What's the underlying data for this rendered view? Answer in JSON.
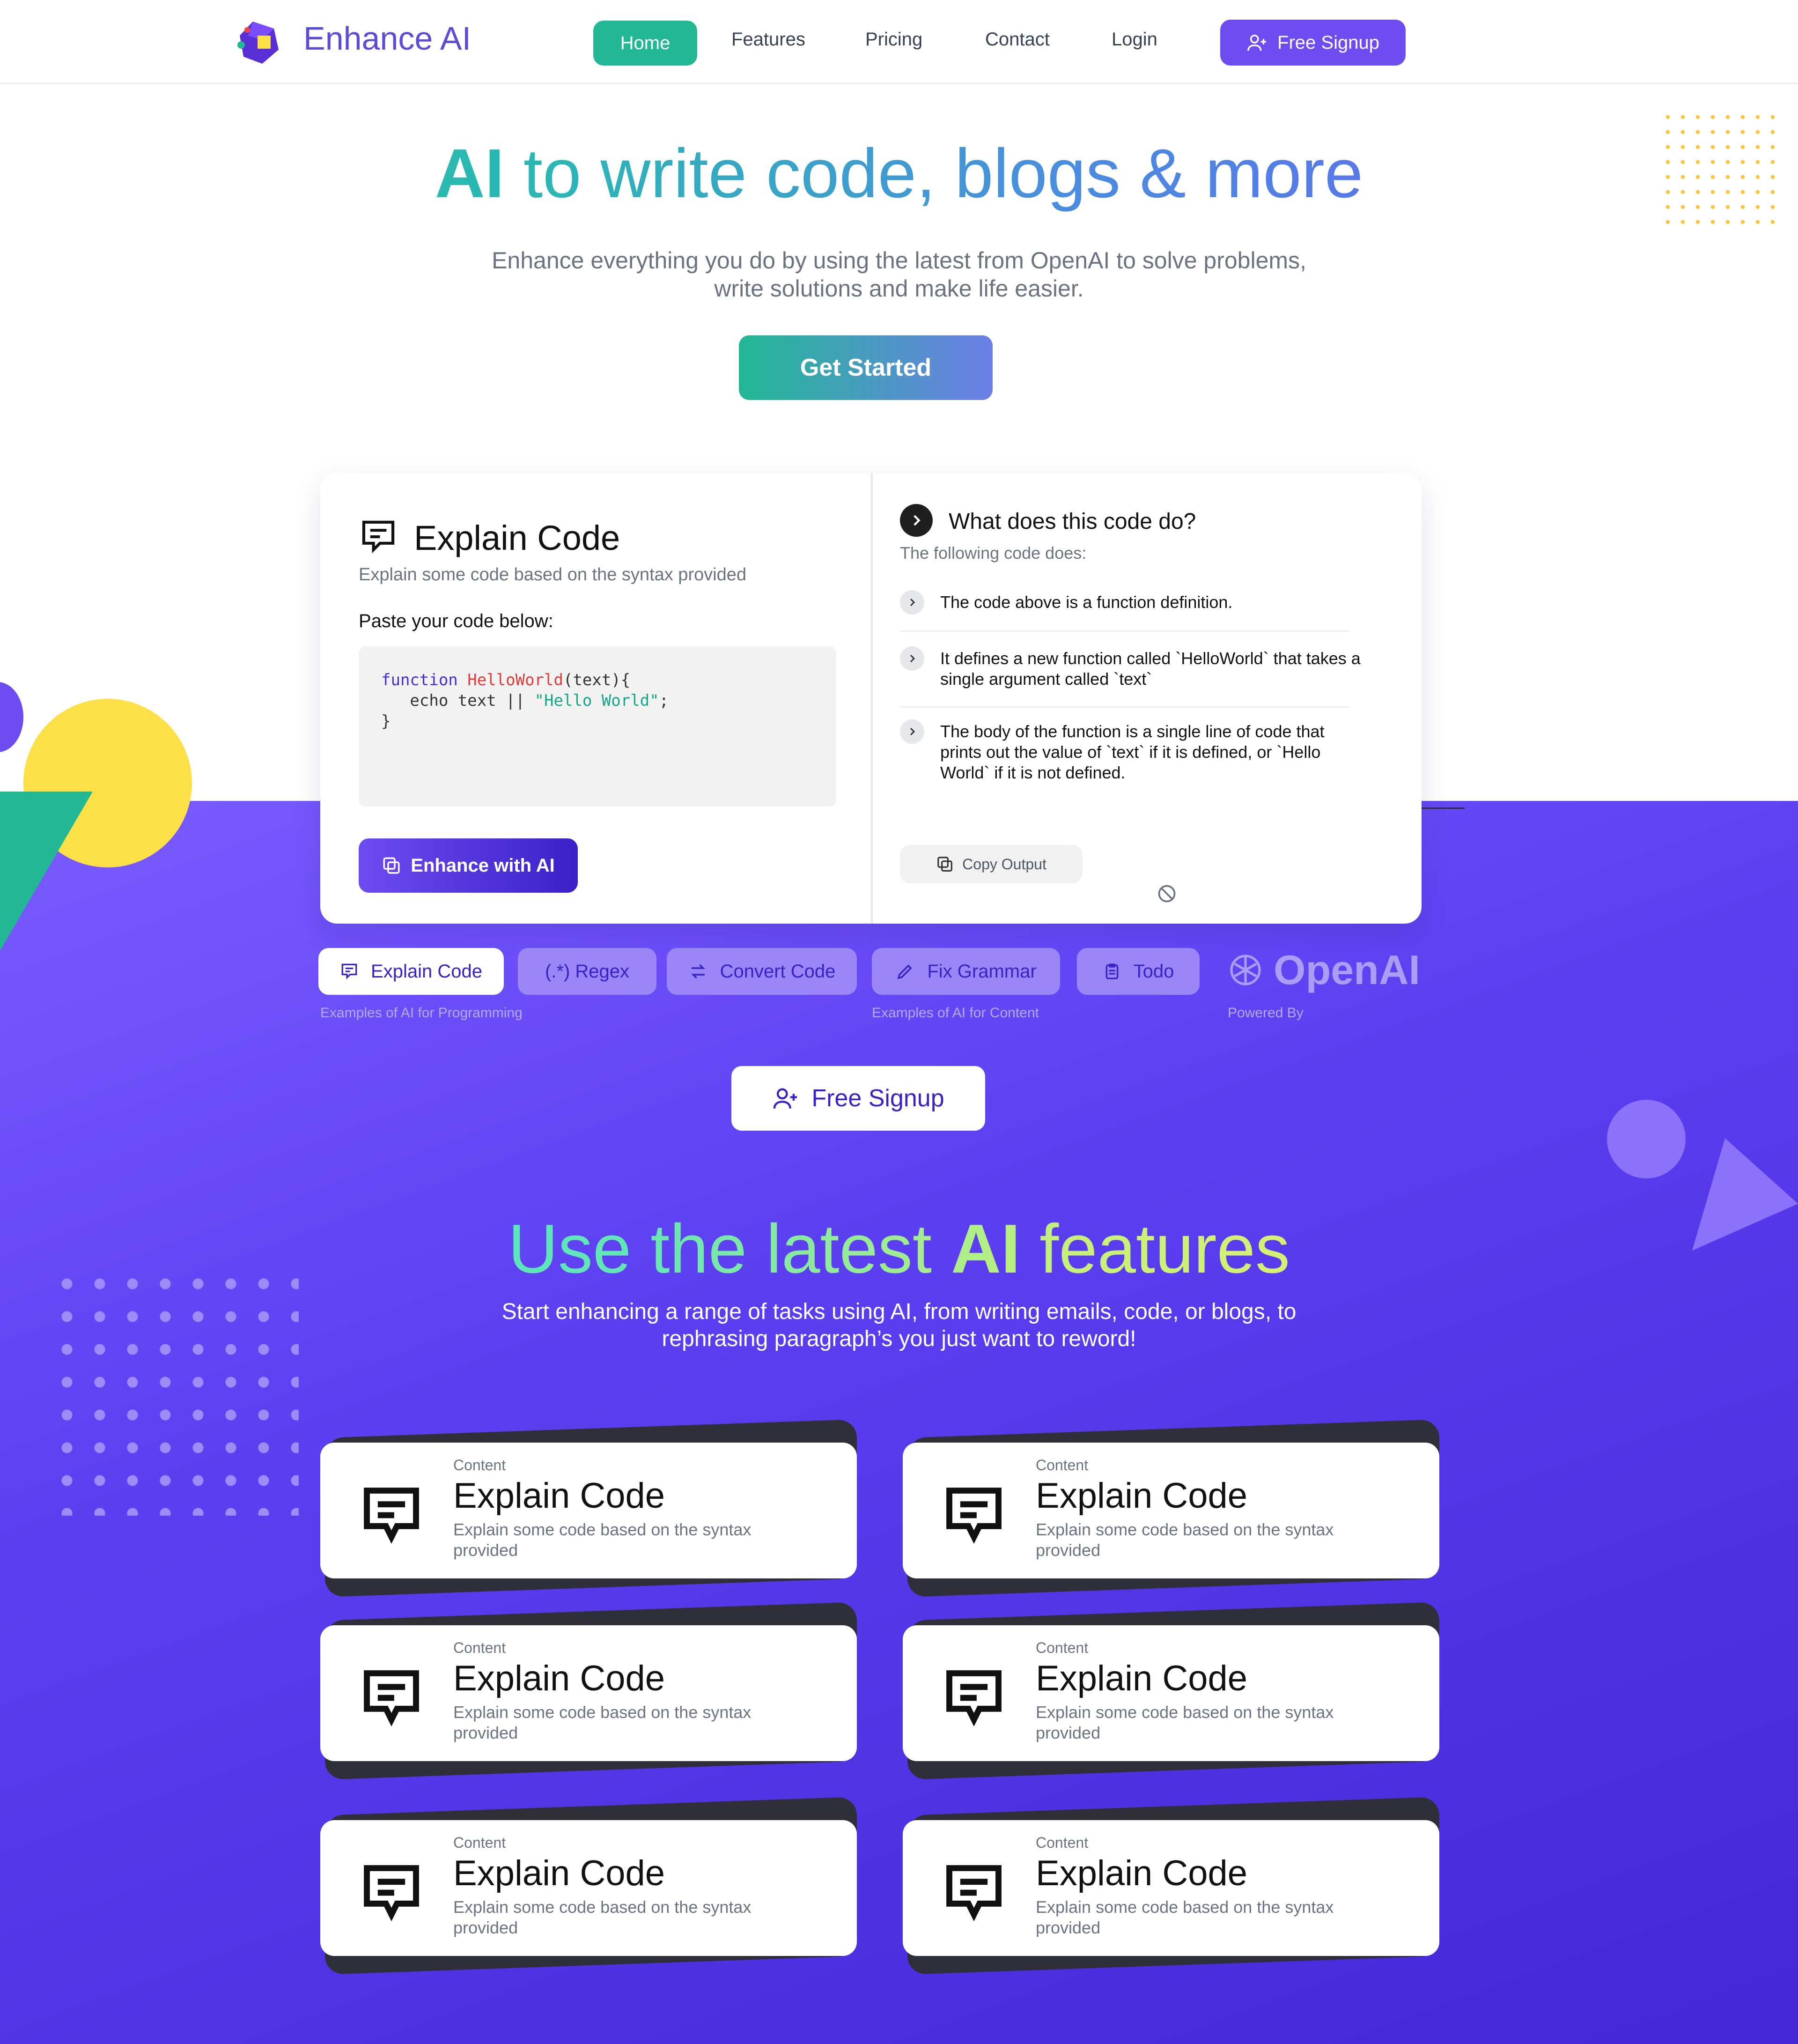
{
  "nav": {
    "brand": "Enhance AI",
    "links": [
      "Home",
      "Features",
      "Pricing",
      "Contact",
      "Login"
    ],
    "signup_label": "Free Signup"
  },
  "hero": {
    "title_ai": "AI",
    "title_rest": " to write code, blogs & more",
    "subtitle": "Enhance everything you do by using the latest from OpenAI to solve problems, write solutions and make life easier.",
    "cta": "Get Started"
  },
  "demo": {
    "title": "Explain Code",
    "subtitle": "Explain some code based on the syntax provided",
    "paste_label": "Paste your code below:",
    "code": {
      "kw": "function",
      "fn": "HelloWorld",
      "sig": "(text){",
      "line2": "   echo text || ",
      "str": "\"Hello World\"",
      "semi": ";",
      "close": "}"
    },
    "enhance_label": "Enhance with AI",
    "question": "What does this code do?",
    "answer_intro": "The following code does:",
    "answers": [
      "The code above is a function definition.",
      "It defines a new function called `HelloWorld` that takes a single argument called `text`",
      "The body of the function is a single line of code that prints out the value of `text` if it is defined, or `Hello World` if it is not defined."
    ],
    "copy_label": "Copy Output"
  },
  "tabs": {
    "items": [
      "Explain Code",
      "(.*)  Regex",
      "Convert Code",
      "Fix Grammar",
      "Todo"
    ],
    "caption_programming": "Examples of AI for Programming",
    "caption_content": "Examples of AI for Content",
    "powered_by": "Powered By",
    "openai": "OpenAI"
  },
  "signup2": "Free Signup",
  "features": {
    "title_a": "Use the latest ",
    "title_b": "AI",
    "title_c": " features",
    "subtitle": "Start enhancing a range of tasks using AI, from writing emails, code, or blogs, to rephrasing paragraph’s you just want to reword!",
    "cards": [
      {
        "category": "Content",
        "title": "Explain Code",
        "desc": "Explain some code based on the syntax provided"
      },
      {
        "category": "Content",
        "title": "Explain Code",
        "desc": "Explain some code based on the syntax provided"
      },
      {
        "category": "Content",
        "title": "Explain Code",
        "desc": "Explain some code based on the syntax provided"
      },
      {
        "category": "Content",
        "title": "Explain Code",
        "desc": "Explain some code based on the syntax provided"
      },
      {
        "category": "Content",
        "title": "Explain Code",
        "desc": "Explain some code based on the syntax provided"
      },
      {
        "category": "Content",
        "title": "Explain Code",
        "desc": "Explain some code based on the syntax provided"
      }
    ]
  },
  "colors": {
    "accent_green": "#22b894",
    "accent_purple": "#6d4cf0",
    "deep_purple": "#3a21c7",
    "yellow": "#fde047"
  }
}
